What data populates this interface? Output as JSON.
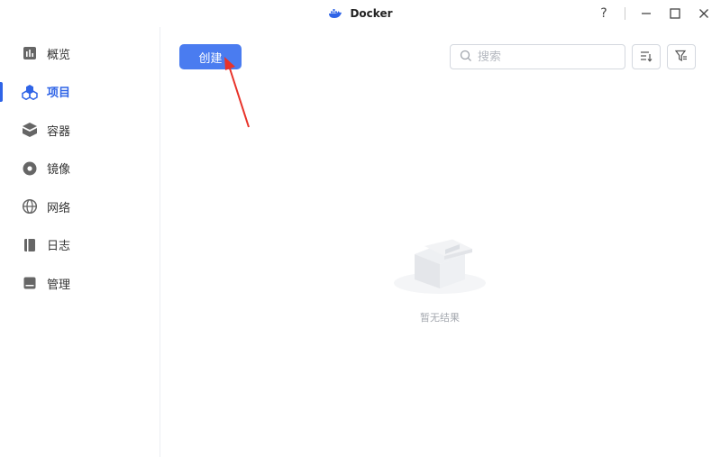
{
  "window": {
    "title": "Docker",
    "help_glyph": "?",
    "icons": [
      "docker-logo-icon",
      "help-icon",
      "minimize-icon",
      "maximize-icon",
      "close-icon"
    ]
  },
  "sidebar": {
    "items": [
      {
        "label": "概览",
        "icon": "overview-icon",
        "active": false
      },
      {
        "label": "项目",
        "icon": "project-icon",
        "active": true
      },
      {
        "label": "容器",
        "icon": "container-icon",
        "active": false
      },
      {
        "label": "镜像",
        "icon": "image-icon",
        "active": false
      },
      {
        "label": "网络",
        "icon": "network-icon",
        "active": false
      },
      {
        "label": "日志",
        "icon": "log-icon",
        "active": false
      },
      {
        "label": "管理",
        "icon": "manage-icon",
        "active": false
      }
    ]
  },
  "toolbar": {
    "create_label": "创建",
    "search_placeholder": "搜索",
    "search_value": ""
  },
  "empty_state": {
    "text": "暂无结果",
    "icon": "empty-box-icon"
  },
  "colors": {
    "accent": "#2f64e7",
    "button": "#4a7cf0",
    "annotation_arrow": "#e8332a"
  }
}
